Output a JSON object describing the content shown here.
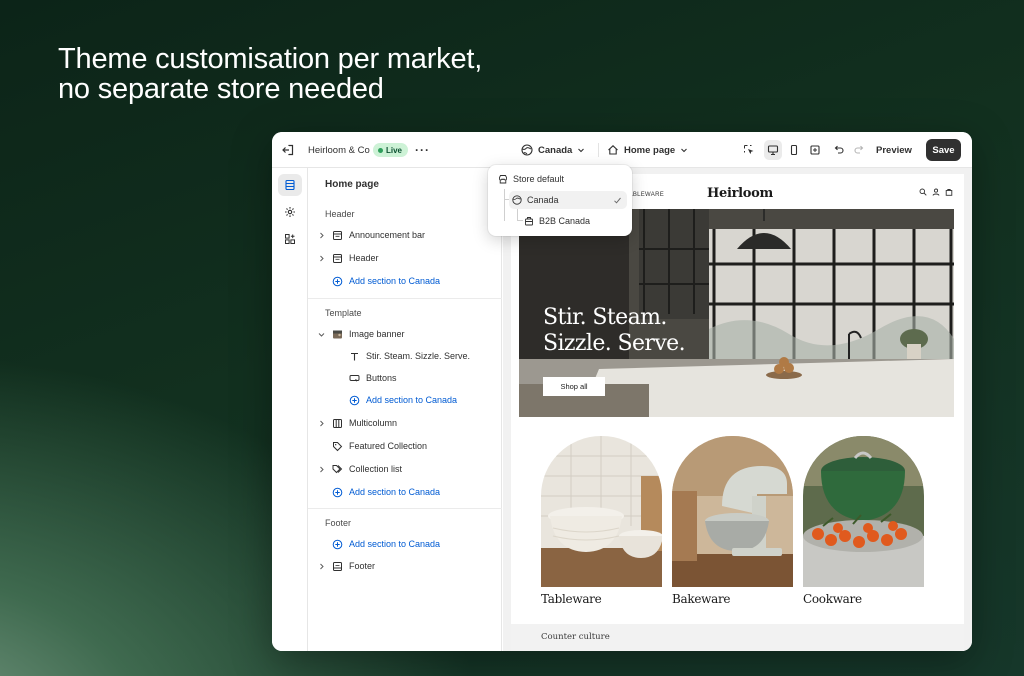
{
  "headline": {
    "line1": "Theme customisation per market,",
    "line2": "no separate store needed"
  },
  "topbar": {
    "store_name": "Heirloom & Co",
    "status_badge": "Live",
    "market_select": "Canada",
    "page_select": "Home page",
    "preview_label": "Preview",
    "save_label": "Save"
  },
  "dropdown": {
    "items": [
      {
        "label": "Store default",
        "icon": "store-icon"
      },
      {
        "label": "Canada",
        "icon": "globe-icon",
        "selected": true
      },
      {
        "label": "B2B Canada",
        "icon": "building-icon"
      }
    ]
  },
  "sidebar": {
    "title": "Home page",
    "header_section": {
      "label": "Header",
      "items": [
        "Announcement bar",
        "Header"
      ],
      "add_label": "Add section to Canada"
    },
    "template_section": {
      "label": "Template",
      "image_banner": "Image banner",
      "banner_children": [
        "Stir. Steam. Sizzle. Serve.",
        "Buttons"
      ],
      "banner_add_label": "Add section to Canada",
      "items": [
        "Multicolumn",
        "Featured Collection",
        "Collection list"
      ],
      "add_label": "Add section to Canada"
    },
    "footer_section": {
      "label": "Footer",
      "add_label": "Add section to Canada",
      "items": [
        "Footer"
      ]
    }
  },
  "store_preview": {
    "nav_text": "TABLEWARE",
    "logo": "Heirloom",
    "hero_line1": "Stir. Steam.",
    "hero_line2": "Sizzle. Serve.",
    "hero_button": "Shop all",
    "collections": [
      "Tableware",
      "Bakeware",
      "Cookware"
    ],
    "counter_title": "Counter culture"
  },
  "colors": {
    "accent_link": "#005bd3",
    "live_badge_bg": "#cdf2d6",
    "save_button_bg": "#303030"
  }
}
